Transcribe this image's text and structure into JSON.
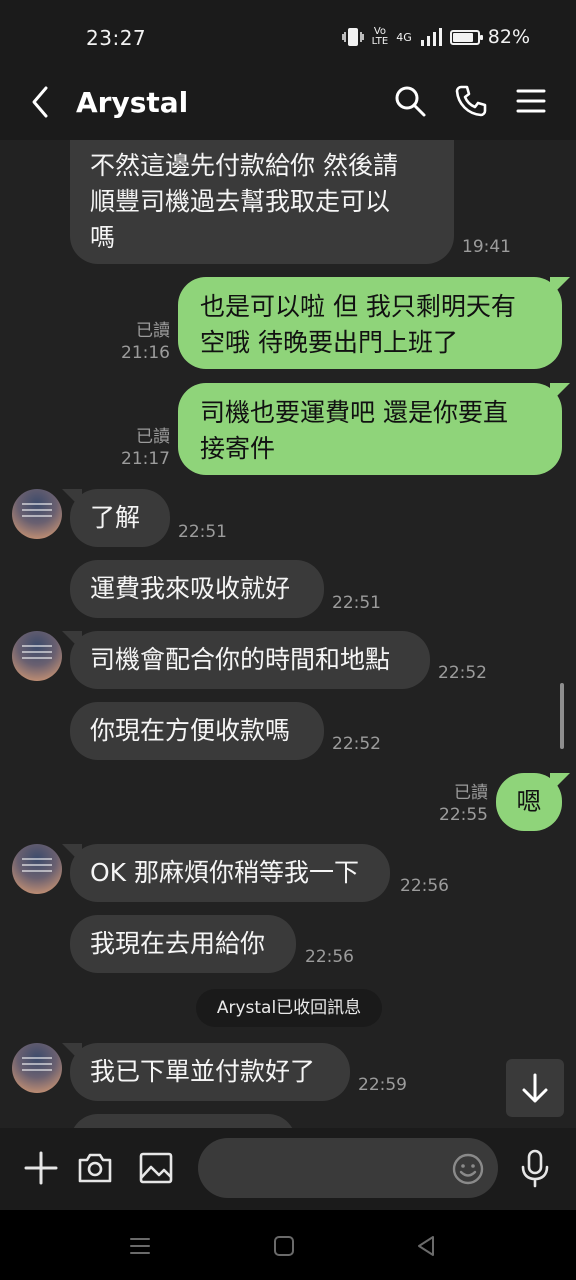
{
  "status_bar": {
    "time": "23:27",
    "network_label": "4G",
    "battery_percent": 82,
    "battery_label": "82%"
  },
  "header": {
    "title": "Arystal"
  },
  "messages": [
    {
      "id": "m1",
      "side": "in",
      "text_lines": [
        "不然這邊先付款給你 然後請",
        "順豐司機過去幫我取走可以",
        "嗎"
      ],
      "time": "19:41"
    },
    {
      "id": "m2",
      "side": "out",
      "text_lines": [
        "也是可以啦 但 我只剩明天有",
        "空哦 待晚要出門上班了"
      ],
      "read": "已讀",
      "time": "21:16"
    },
    {
      "id": "m3",
      "side": "out",
      "text_lines": [
        "司機也要運費吧 還是你要直",
        "接寄件"
      ],
      "read": "已讀",
      "time": "21:17"
    },
    {
      "id": "m4",
      "side": "in",
      "text_lines": [
        "了解"
      ],
      "time": "22:51"
    },
    {
      "id": "m5",
      "side": "in",
      "text_lines": [
        "運費我來吸收就好"
      ],
      "time": "22:51"
    },
    {
      "id": "m6",
      "side": "in",
      "text_lines": [
        "司機會配合你的時間和地點"
      ],
      "time": "22:52"
    },
    {
      "id": "m7",
      "side": "in",
      "text_lines": [
        "你現在方便收款嗎"
      ],
      "time": "22:52"
    },
    {
      "id": "m8",
      "side": "out",
      "text_lines": [
        "嗯"
      ],
      "read": "已讀",
      "time": "22:55"
    },
    {
      "id": "m9",
      "side": "in",
      "text_lines": [
        "OK 那麻煩你稍等我一下"
      ],
      "time": "22:56"
    },
    {
      "id": "m10",
      "side": "in",
      "text_lines": [
        "我現在去用給你"
      ],
      "time": "22:56"
    },
    {
      "id": "m11",
      "side": "in",
      "text_lines": [
        "我已下單並付款好了"
      ],
      "time": "22:59"
    }
  ],
  "system_notice": "Arystal已收回訊息",
  "input": {
    "placeholder": ""
  },
  "colors": {
    "background": "#222222",
    "incoming_bubble": "#3a3a3a",
    "outgoing_bubble": "#8fd47a",
    "meta_text": "#9c9c9c"
  },
  "icons": {
    "header": [
      "back-icon",
      "search-icon",
      "phone-icon",
      "menu-icon"
    ],
    "input_bar": [
      "plus-icon",
      "camera-icon",
      "image-icon",
      "emoji-icon",
      "mic-icon"
    ],
    "nav": [
      "recent-apps-icon",
      "home-icon",
      "back-nav-icon"
    ]
  }
}
